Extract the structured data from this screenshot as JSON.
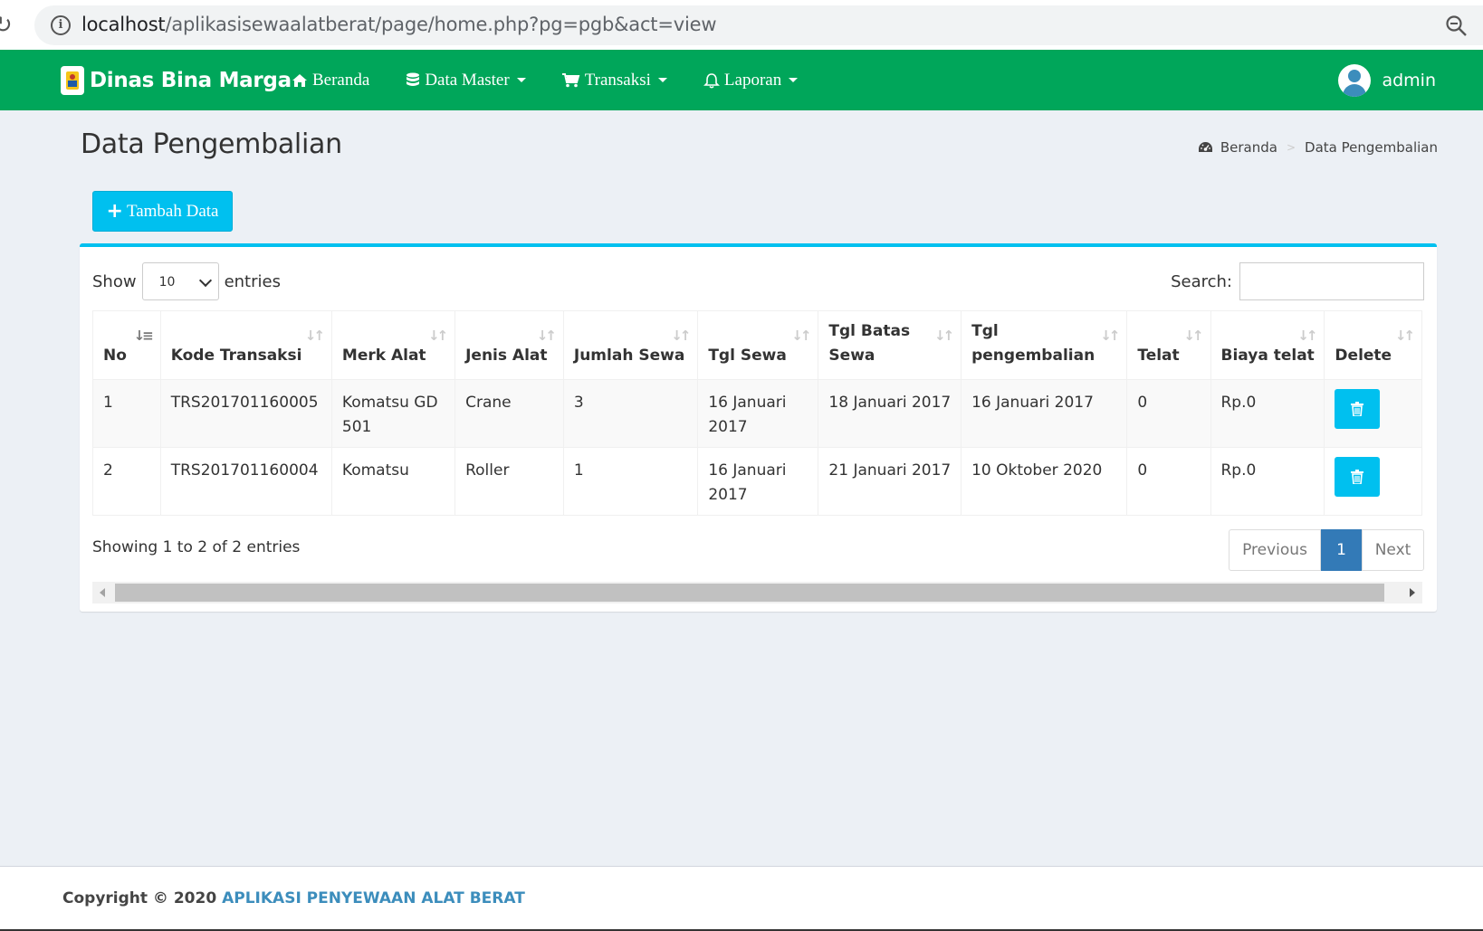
{
  "browser": {
    "url_host": "localhost",
    "url_path": "/aplikasisewaalatberat/page/home.php?pg=pgb&act=view"
  },
  "navbar": {
    "brand": "Dinas Bina Marga",
    "menu": [
      {
        "label": "Beranda",
        "icon": "home-icon",
        "dropdown": false
      },
      {
        "label": "Data Master",
        "icon": "database-icon",
        "dropdown": true
      },
      {
        "label": "Transaksi",
        "icon": "cart-icon",
        "dropdown": true
      },
      {
        "label": "Laporan",
        "icon": "bell-icon",
        "dropdown": true
      }
    ],
    "user": "admin",
    "color": "#00a65a"
  },
  "header": {
    "title": "Data Pengembalian",
    "breadcrumb": [
      "Beranda",
      "Data Pengembalian"
    ]
  },
  "toolbar": {
    "add_label": "Tambah Data"
  },
  "table_controls": {
    "show_label": "Show",
    "entries_value": "10",
    "entries_label": "entries",
    "search_label": "Search:"
  },
  "table": {
    "columns": [
      "No",
      "Kode Transaksi",
      "Merk Alat",
      "Jenis Alat",
      "Jumlah Sewa",
      "Tgl Sewa",
      "Tgl Batas Sewa",
      "Tgl pengembalian",
      "Telat",
      "Biaya telat",
      "Delete"
    ],
    "rows": [
      [
        "1",
        "TRS201701160005",
        "Komatsu GD 501",
        "Crane",
        "3",
        "16 Januari 2017",
        "18 Januari 2017",
        "16 Januari 2017",
        "0",
        "Rp.0"
      ],
      [
        "2",
        "TRS201701160004",
        "Komatsu",
        "Roller",
        "1",
        "16 Januari 2017",
        "21 Januari 2017",
        "10 Oktober 2020",
        "0",
        "Rp.0"
      ]
    ]
  },
  "pagination": {
    "info": "Showing 1 to 2 of 2 entries",
    "previous": "Previous",
    "current": "1",
    "next": "Next"
  },
  "footer": {
    "prefix": "Copyright © 2020",
    "app_name": "APLIKASI PENYEWAAN ALAT BERAT"
  }
}
